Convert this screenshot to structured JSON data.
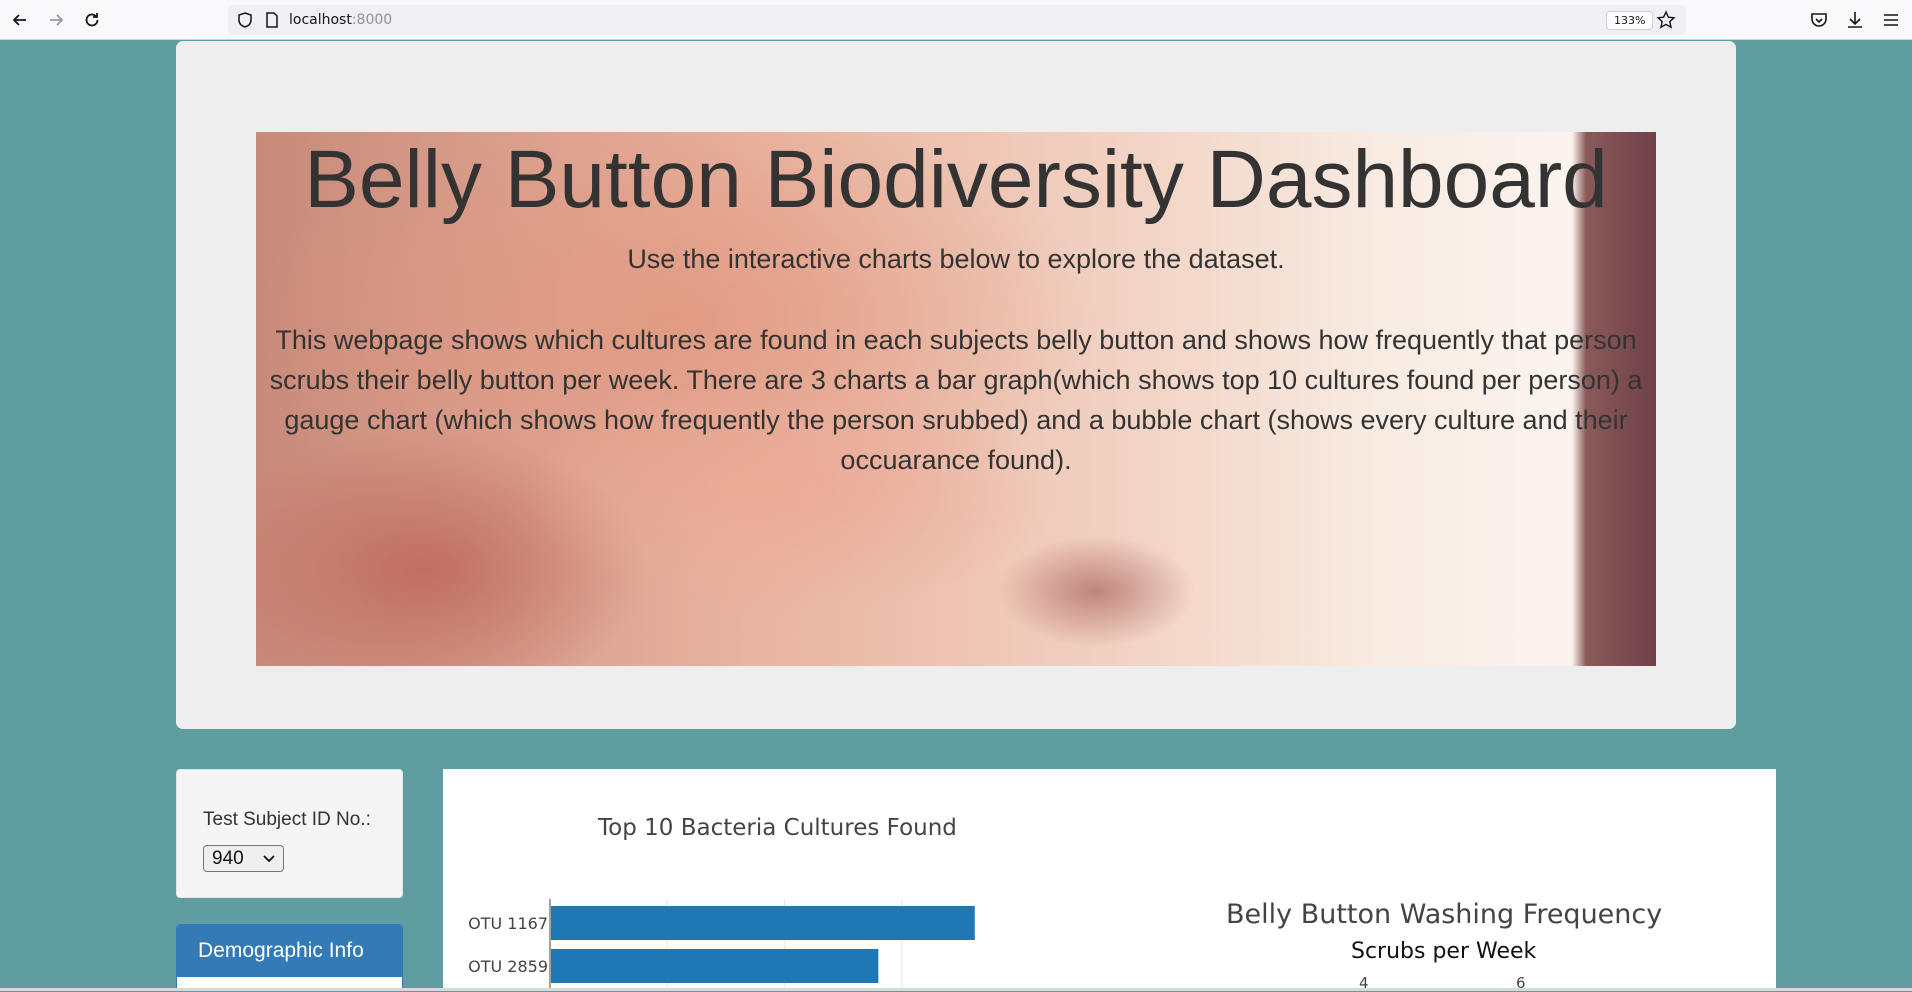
{
  "browser": {
    "url_host": "localhost",
    "url_port": ":8000",
    "zoom": "133%"
  },
  "hero": {
    "title": "Belly Button Biodiversity Dashboard",
    "lead": "Use the interactive charts below to explore the dataset.",
    "description": "This webpage shows which cultures are found in each subjects belly button and shows how frequently that person scrubs their belly button per week. There are 3 charts a bar graph(which shows top 10 cultures found per person) a gauge chart (which shows how frequently the person srubbed) and a bubble chart (shows every culture and their occuarance found)."
  },
  "selector": {
    "label": "Test Subject ID No.:",
    "value": "940"
  },
  "demographics": {
    "heading": "Demographic Info"
  },
  "gauge": {
    "title": "Belly Button Washing Frequency",
    "subtitle": "Scrubs per Week",
    "visible_ticks": [
      "4",
      "6"
    ]
  },
  "chart_data": {
    "type": "bar",
    "orientation": "horizontal",
    "title": "Top 10 Bacteria Cultures Found",
    "categories": [
      "OTU 1167",
      "OTU 2859"
    ],
    "values": [
      163,
      126
    ],
    "xlim": [
      0,
      165
    ],
    "grid": true,
    "color": "#1f77b4"
  },
  "colors": {
    "page_background": "#5f9ea0",
    "jumbotron": "#eeeeee",
    "panel_heading": "#337ab7",
    "bar": "#1f77b4"
  }
}
